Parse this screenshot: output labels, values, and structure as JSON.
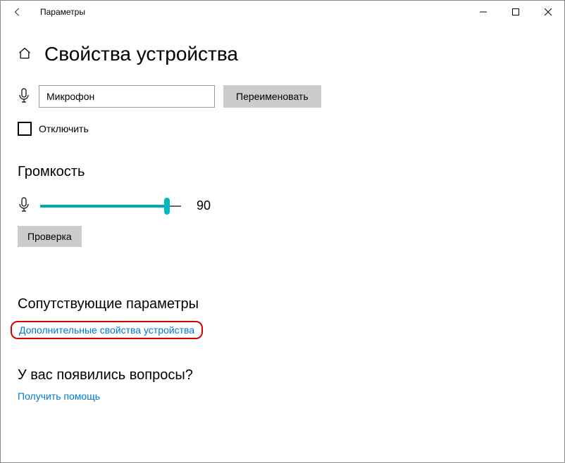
{
  "window": {
    "title": "Параметры"
  },
  "page": {
    "title": "Свойства устройства"
  },
  "device": {
    "name": "Микрофон",
    "rename_button": "Переименовать",
    "disable_label": "Отключить"
  },
  "volume": {
    "heading": "Громкость",
    "value": "90",
    "percent": 90,
    "test_button": "Проверка"
  },
  "related": {
    "heading": "Сопутствующие параметры",
    "advanced_link": "Дополнительные свойства устройства"
  },
  "help": {
    "heading": "У вас появились вопросы?",
    "link": "Получить помощь"
  }
}
